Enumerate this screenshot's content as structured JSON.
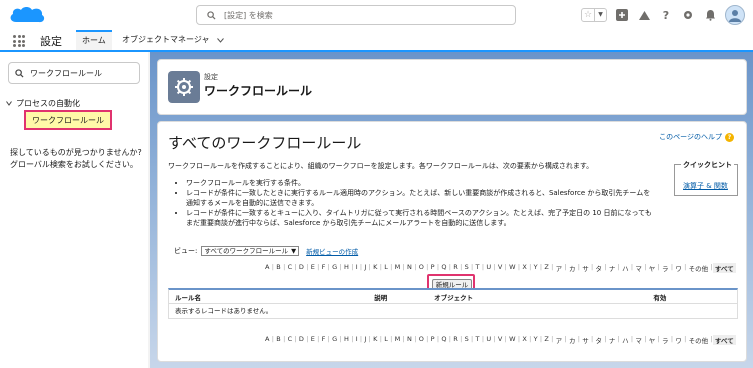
{
  "header": {
    "search_placeholder": "[設定] を検索"
  },
  "nav": {
    "app_name": "設定",
    "tabs": [
      {
        "label": "ホーム"
      },
      {
        "label": "オブジェクトマネージャ"
      }
    ]
  },
  "sidebar": {
    "quickfind_value": "ワークフロールール",
    "parent_item": "プロセスの自動化",
    "child_item": "ワークフロールール",
    "help_text_line1": "探しているものが見つかりませんか?",
    "help_text_line2": "グローバル検索をお試しください。"
  },
  "setup_header": {
    "subtitle": "設定",
    "title": "ワークフロールール"
  },
  "main": {
    "title": "すべてのワークフロールール",
    "page_help": "このページのヘルプ",
    "intro": "ワークフロールールを作成することにより、組織のワークフローを設定します。各ワークフロールールは、次の要素から構成されます。",
    "bullets": [
      "ワークフロールールを実行する条件。",
      "レコードが条件に一致したときに実行するルール適用時のアクション。たとえば、新しい重要商談が作成されると、Salesforce から取引先チームを通知するメールを自動的に送信できます。",
      "レコードが条件に一致するとキューに入り、タイムトリガに従って実行される時間ベースのアクション。たとえば、完了予定日の 10 日前になってもまだ重要商談が進行中ならば、Salesforce から取引先チームにメールアラートを自動的に送信します。"
    ],
    "quick_hint_title": "クイックヒント",
    "quick_hint_link": "演算子 & 関数",
    "view_label": "ビュー:",
    "view_selected": "すべてのワークフロールール",
    "new_view_link": "新規ビューの作成",
    "alphabet": [
      "A",
      "B",
      "C",
      "D",
      "E",
      "F",
      "G",
      "H",
      "I",
      "J",
      "K",
      "L",
      "M",
      "N",
      "O",
      "P",
      "Q",
      "R",
      "S",
      "T",
      "U",
      "V",
      "W",
      "X",
      "Y",
      "Z",
      "ア",
      "カ",
      "サ",
      "タ",
      "ナ",
      "ハ",
      "マ",
      "ヤ",
      "ラ",
      "ワ",
      "その他",
      "すべて"
    ],
    "new_rule_button": "新規ルール",
    "columns": [
      "ルール名",
      "説明",
      "オブジェクト",
      "有効"
    ],
    "empty_message": "表示するレコードはありません。"
  }
}
